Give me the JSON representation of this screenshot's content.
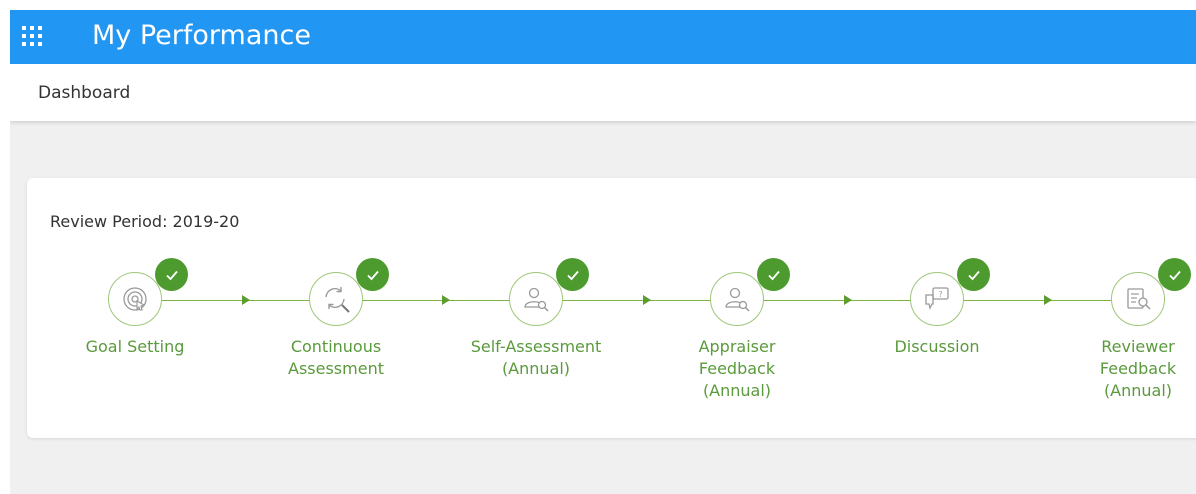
{
  "header": {
    "title": "My Performance",
    "menu_icon": "apps-grid-icon"
  },
  "nav": {
    "dashboard": "Dashboard"
  },
  "review": {
    "period_label": "Review Period: 2019-20",
    "steps": [
      {
        "label": "Goal Setting",
        "icon": "target-icon",
        "completed": true
      },
      {
        "label": "Continuous\nAssessment",
        "icon": "refresh-search-icon",
        "completed": true
      },
      {
        "label": "Self-Assessment\n(Annual)",
        "icon": "user-search-icon",
        "completed": true
      },
      {
        "label": "Appraiser\nFeedback\n(Annual)",
        "icon": "user-search-icon",
        "completed": true
      },
      {
        "label": "Discussion",
        "icon": "chat-question-icon",
        "completed": true
      },
      {
        "label": "Reviewer\nFeedback\n(Annual)",
        "icon": "document-search-icon",
        "completed": true
      }
    ]
  },
  "colors": {
    "header": "#2196f3",
    "accent_green": "#4d9a2f",
    "step_text": "#5a9a3c"
  }
}
